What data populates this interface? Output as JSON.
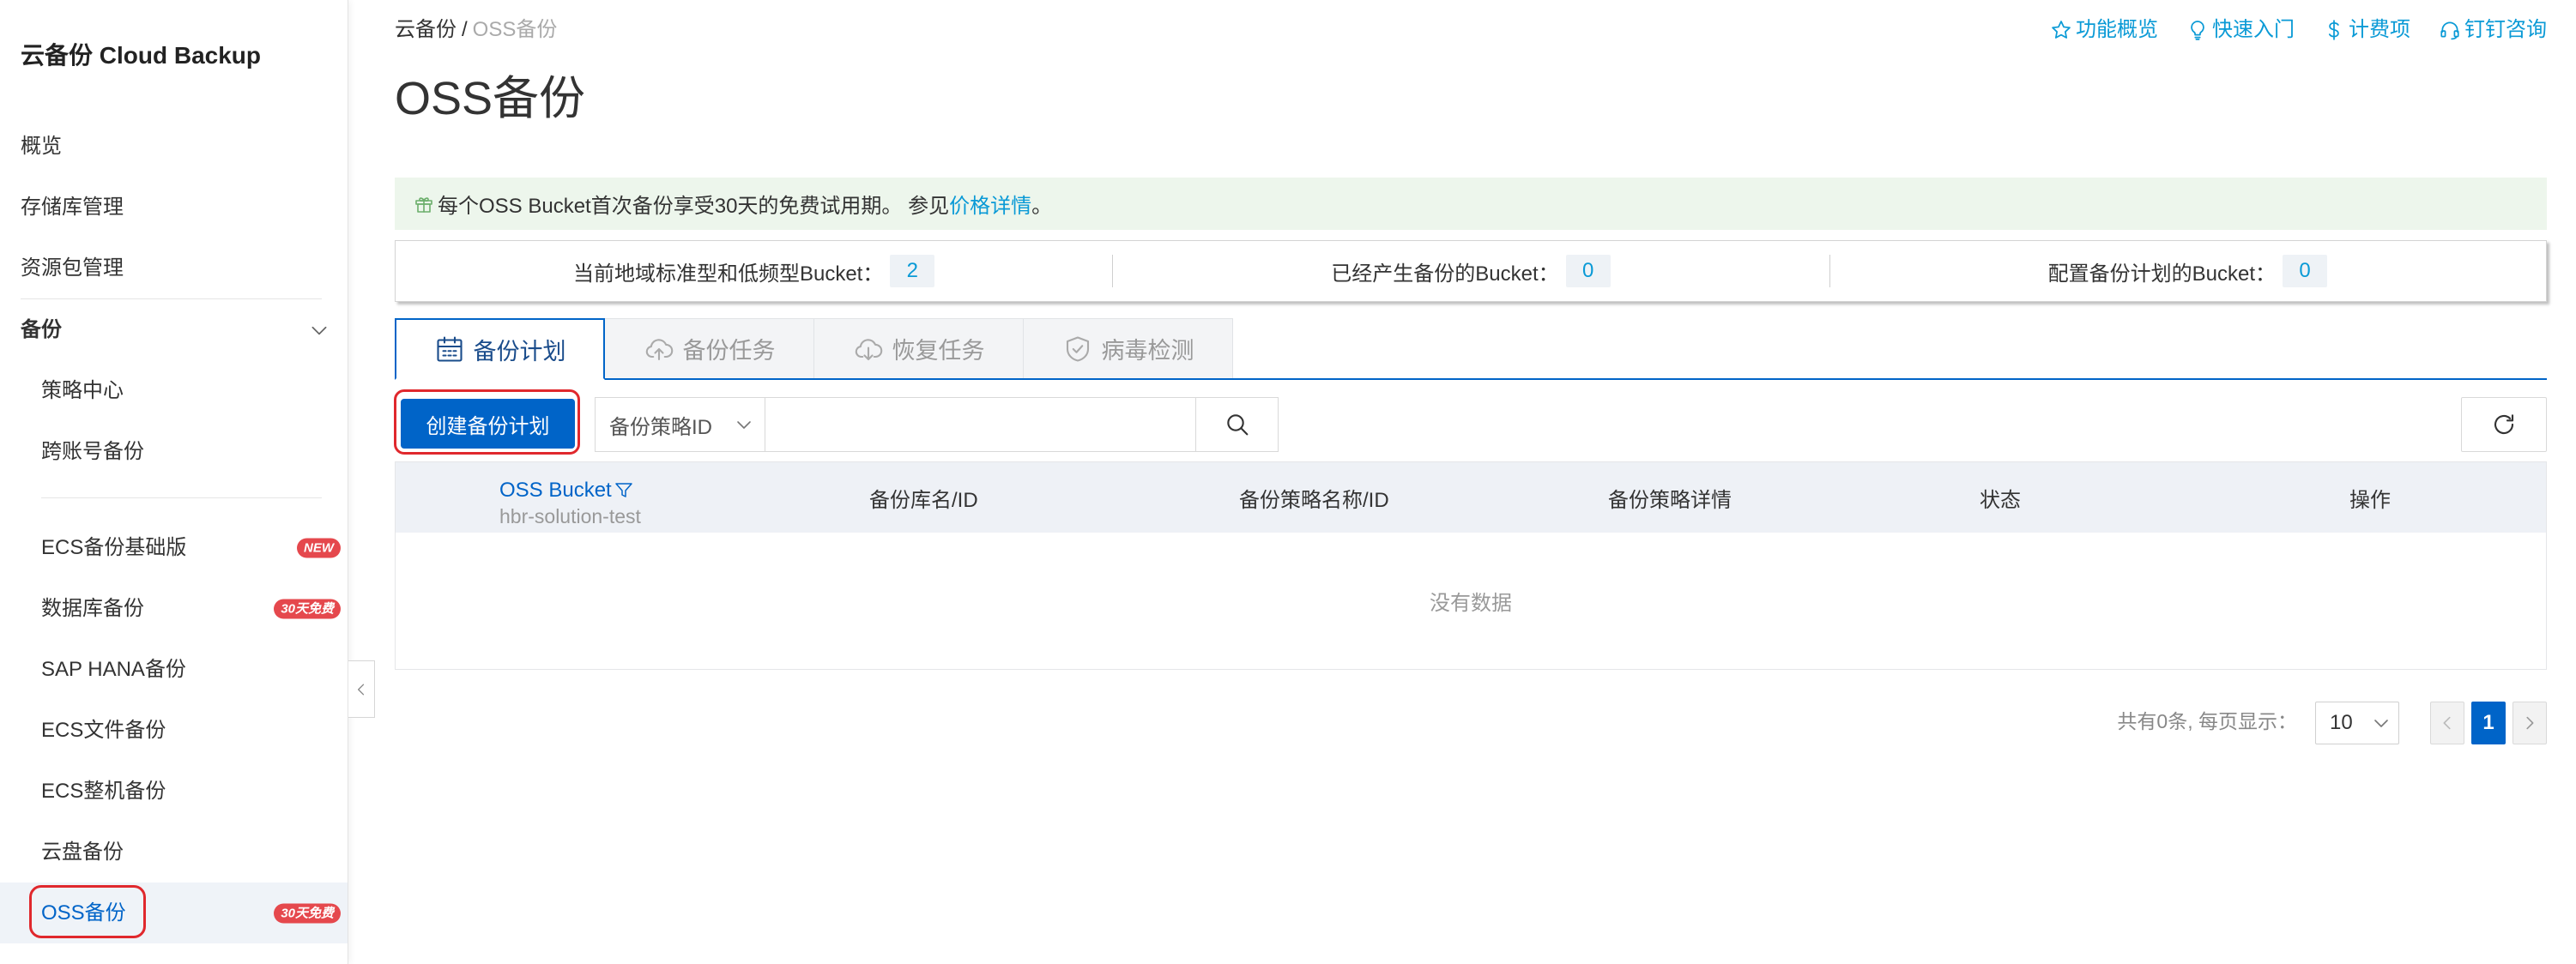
{
  "sidebar": {
    "title": "云备份 Cloud Backup",
    "top_items": [
      {
        "label": "概览"
      },
      {
        "label": "存储库管理"
      },
      {
        "label": "资源包管理"
      }
    ],
    "backup_group": {
      "label": "备份",
      "icon": "chevron-down-icon",
      "items": [
        {
          "label": "策略中心"
        },
        {
          "label": "跨账号备份"
        }
      ]
    },
    "products": [
      {
        "label": "ECS备份基础版",
        "badge": "NEW"
      },
      {
        "label": "数据库备份",
        "badge": "30天免费"
      },
      {
        "label": "SAP HANA备份"
      },
      {
        "label": "ECS文件备份"
      },
      {
        "label": "ECS整机备份"
      },
      {
        "label": "云盘备份"
      },
      {
        "label": "OSS备份",
        "badge": "30天免费",
        "active": true
      }
    ],
    "collapse_icon": "chevron-left-icon"
  },
  "breadcrumb": {
    "root": "云备份",
    "separator": "/",
    "current": "OSS备份"
  },
  "header_links": [
    {
      "label": "功能概览",
      "icon": "star-icon"
    },
    {
      "label": "快速入门",
      "icon": "bulb-icon"
    },
    {
      "label": "计费项",
      "icon": "dollar-icon"
    },
    {
      "label": "钉钉咨询",
      "icon": "headset-icon"
    }
  ],
  "page_title": "OSS备份",
  "notice": {
    "icon": "gift-icon",
    "text": "每个OSS Bucket首次备份享受30天的免费试用期。 参见",
    "link": "价格详情",
    "suffix": "。"
  },
  "stats": [
    {
      "label": "当前地域标准型和低频型Bucket：",
      "value": "2"
    },
    {
      "label": "已经产生备份的Bucket：",
      "value": "0"
    },
    {
      "label": "配置备份计划的Bucket：",
      "value": "0"
    }
  ],
  "tabs": [
    {
      "label": "备份计划",
      "icon": "calendar-icon",
      "active": true
    },
    {
      "label": "备份任务",
      "icon": "cloud-upload-icon"
    },
    {
      "label": "恢复任务",
      "icon": "cloud-download-icon"
    },
    {
      "label": "病毒检测",
      "icon": "shield-check-icon"
    }
  ],
  "toolbar": {
    "create_label": "创建备份计划",
    "filter_select": "备份策略ID",
    "search_value": "",
    "search_icon": "search-icon",
    "refresh_icon": "refresh-icon"
  },
  "table": {
    "columns": [
      {
        "label": "OSS Bucket",
        "sub": "hbr-solution-test",
        "icon": "filter-icon"
      },
      {
        "label": "备份库名/ID"
      },
      {
        "label": "备份策略名称/ID"
      },
      {
        "label": "备份策略详情"
      },
      {
        "label": "状态"
      },
      {
        "label": "操作"
      }
    ],
    "rows": [],
    "empty_text": "没有数据"
  },
  "pagination": {
    "summary": "共有0条, 每页显示：",
    "page_size": "10",
    "current_page": "1"
  },
  "colors": {
    "primary": "#0064c8",
    "link": "#0a9ad6",
    "highlight": "#e0282d",
    "badge": "#e5484d",
    "notice_bg": "#edf6ec"
  }
}
